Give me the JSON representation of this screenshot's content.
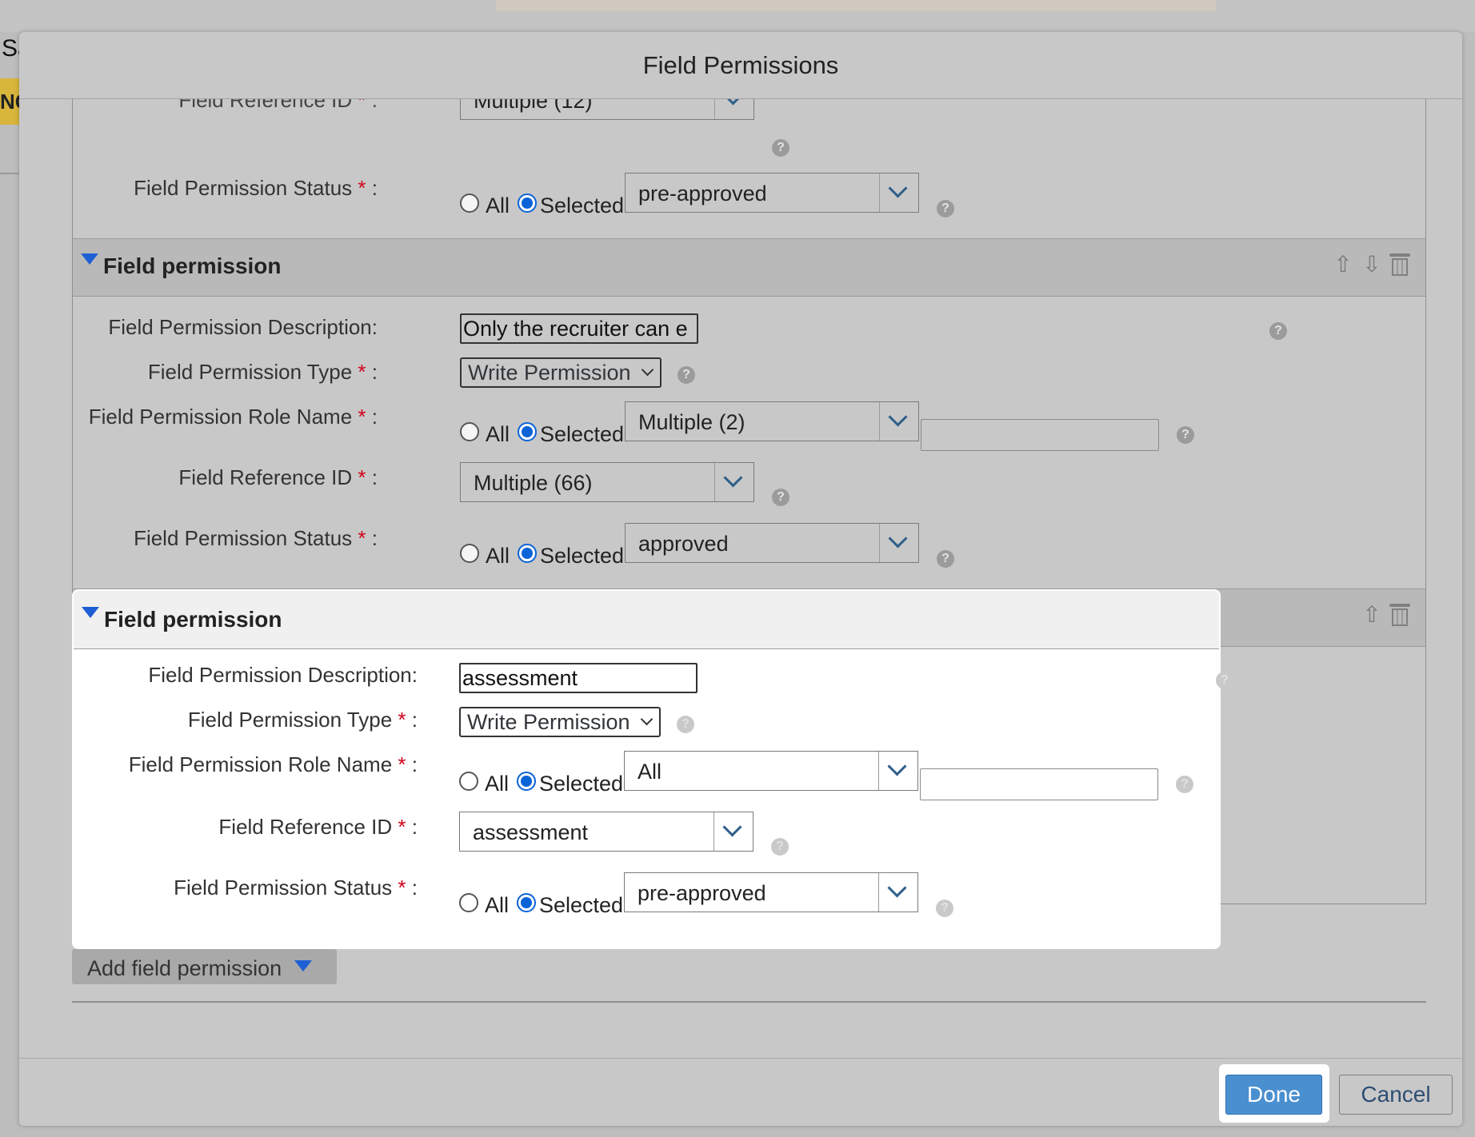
{
  "background": {
    "fragment_left": "Sa",
    "fragment_badge": "NC"
  },
  "dialog": {
    "title": "Field Permissions"
  },
  "labels": {
    "description": "Field Permission Description:",
    "type": "Field Permission Type",
    "role_name": "Field Permission Role Name",
    "reference_id": "Field Reference ID",
    "status": "Field Permission Status",
    "required_mark": "*",
    "colon": ":",
    "radio_all": "All",
    "radio_selected": "Selected"
  },
  "partial_top": {
    "reference_id_value": "Multiple (12)",
    "status_value": "pre-approved"
  },
  "sections": [
    {
      "title": "Field permission",
      "description": "Only the recruiter can e",
      "type": "Write Permission",
      "role_value": "Multiple (2)",
      "role_extra": "",
      "reference_value": "Multiple (66)",
      "status_value": "approved"
    },
    {
      "title": "Field permission",
      "description": "assessment",
      "type": "Write Permission",
      "role_value": "All",
      "role_extra": "",
      "reference_value": "assessment",
      "status_value": "pre-approved"
    }
  ],
  "icons": {
    "help": "?",
    "up": "⇧",
    "down": "⇩"
  },
  "actions": {
    "add_field_permission": "Add field permission",
    "done": "Done",
    "cancel": "Cancel"
  }
}
